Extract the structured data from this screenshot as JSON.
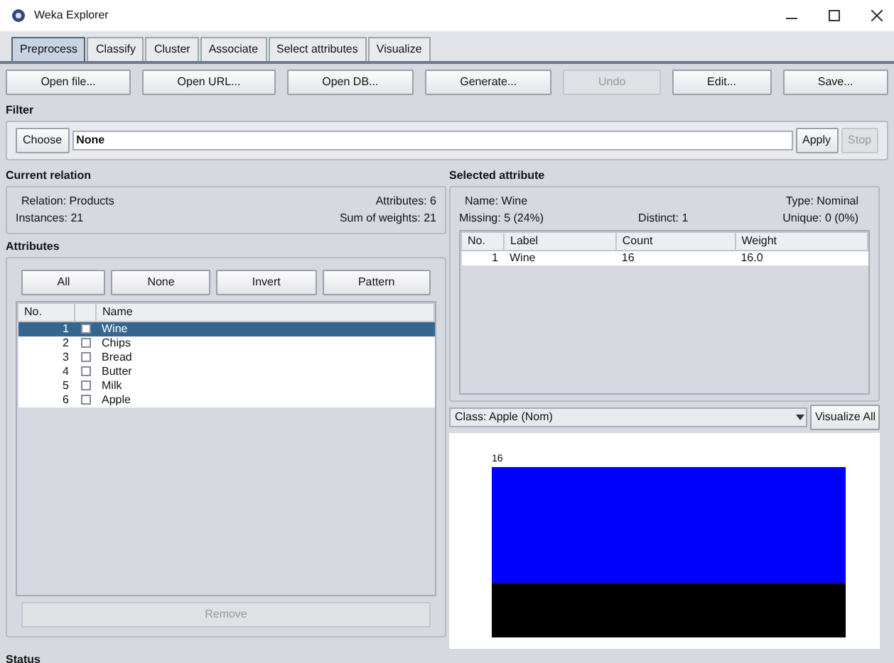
{
  "window": {
    "title": "Weka Explorer"
  },
  "tabs": [
    {
      "label": "Preprocess",
      "selected": true
    },
    {
      "label": "Classify",
      "selected": false
    },
    {
      "label": "Cluster",
      "selected": false
    },
    {
      "label": "Associate",
      "selected": false
    },
    {
      "label": "Select attributes",
      "selected": false
    },
    {
      "label": "Visualize",
      "selected": false
    }
  ],
  "toolbar": [
    {
      "label": "Open file...",
      "disabled": false
    },
    {
      "label": "Open URL...",
      "disabled": false
    },
    {
      "label": "Open DB...",
      "disabled": false
    },
    {
      "label": "Generate...",
      "disabled": false
    },
    {
      "label": "Undo",
      "disabled": true
    },
    {
      "label": "Edit...",
      "disabled": false
    },
    {
      "label": "Save...",
      "disabled": false
    }
  ],
  "filter": {
    "title": "Filter",
    "choose": "Choose",
    "value": "None",
    "apply": {
      "label": "Apply",
      "disabled": false
    },
    "stop": {
      "label": "Stop",
      "disabled": true
    }
  },
  "current_relation": {
    "title": "Current relation",
    "relation": "Relation: Products",
    "attributes": "Attributes: 6",
    "instances": "Instances: 21",
    "sum_of_weights": "Sum of weights: 21"
  },
  "attributes": {
    "title": "Attributes",
    "buttons": [
      "All",
      "None",
      "Invert",
      "Pattern"
    ],
    "columns": [
      "No.",
      "Name"
    ],
    "rows": [
      {
        "no": "1",
        "name": "Wine",
        "checked": false,
        "selected": true
      },
      {
        "no": "2",
        "name": "Chips",
        "checked": false,
        "selected": false
      },
      {
        "no": "3",
        "name": "Bread",
        "checked": false,
        "selected": false
      },
      {
        "no": "4",
        "name": "Butter",
        "checked": false,
        "selected": false
      },
      {
        "no": "5",
        "name": "Milk",
        "checked": false,
        "selected": false
      },
      {
        "no": "6",
        "name": "Apple",
        "checked": false,
        "selected": false
      }
    ],
    "remove": {
      "label": "Remove",
      "disabled": true
    }
  },
  "selected_attribute": {
    "title": "Selected attribute",
    "name": "Name: Wine",
    "type": "Type: Nominal",
    "missing": "Missing: 5 (24%)",
    "distinct": "Distinct: 1",
    "unique": "Unique: 0 (0%)",
    "columns": [
      "No.",
      "Label",
      "Count",
      "Weight"
    ],
    "rows": [
      [
        "1",
        "Wine",
        "16",
        "16.0"
      ]
    ]
  },
  "class_select": {
    "value": "Class: Apple (Nom)",
    "visualize": "Visualize All"
  },
  "histogram": {
    "label": "16",
    "segments": [
      {
        "color": "#0000ff"
      },
      {
        "color": "#000000"
      }
    ]
  },
  "status": {
    "title": "Status"
  }
}
